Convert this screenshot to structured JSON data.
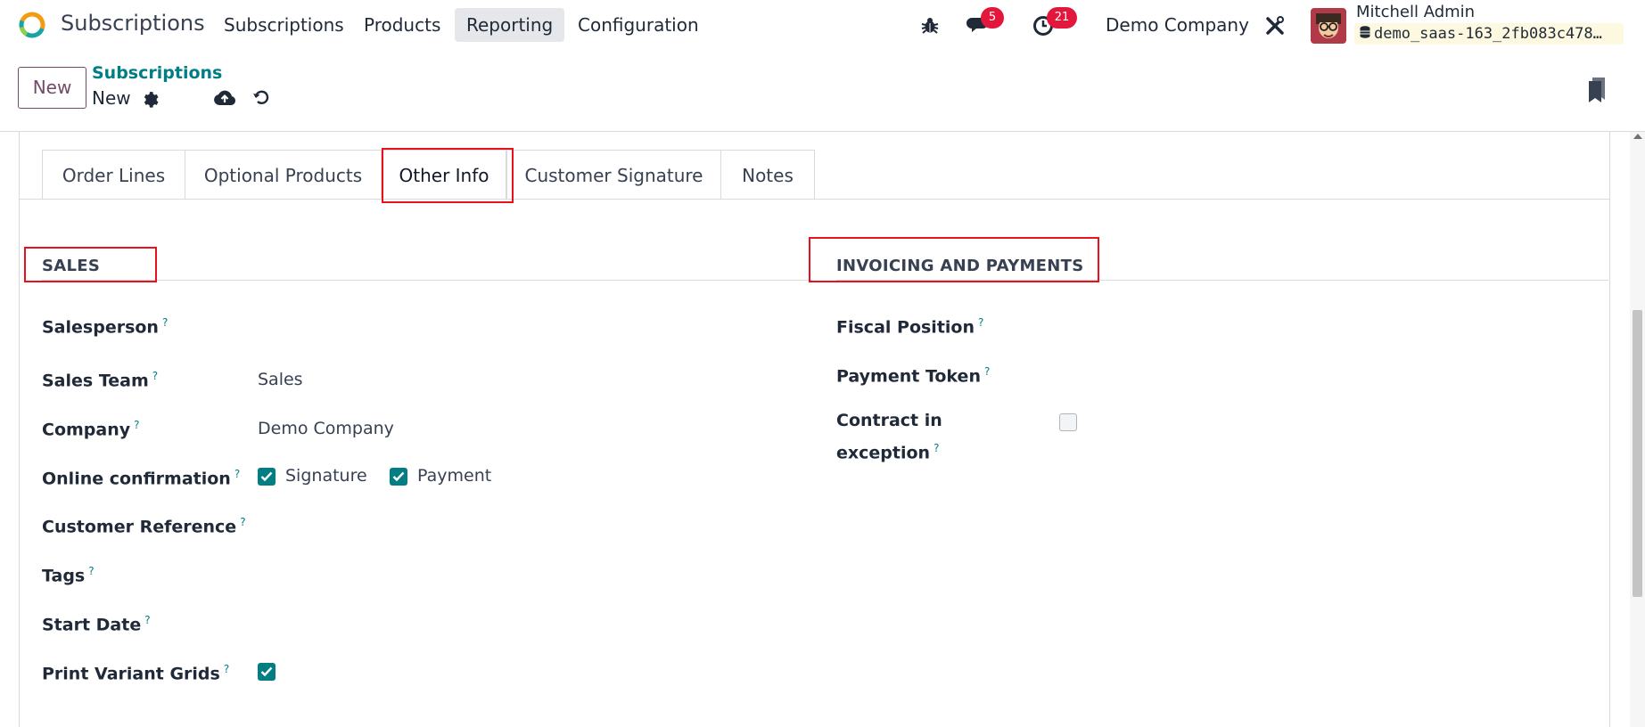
{
  "navbar": {
    "app_name": "Subscriptions",
    "menu": [
      "Subscriptions",
      "Products",
      "Reporting",
      "Configuration"
    ],
    "active_menu": "Reporting",
    "messages_count": "5",
    "activities_count": "21",
    "company": "Demo Company",
    "user_name": "Mitchell Admin",
    "database": "demo_saas-163_2fb083c478…"
  },
  "control": {
    "new_label": "New",
    "breadcrumb": "Subscriptions",
    "record_name": "New"
  },
  "tabs": [
    "Order Lines",
    "Optional Products",
    "Other Info",
    "Customer Signature",
    "Notes"
  ],
  "active_tab": "Other Info",
  "sales": {
    "title": "SALES",
    "salesperson_label": "Salesperson",
    "sales_team_label": "Sales Team",
    "sales_team_value": "Sales",
    "company_label": "Company",
    "company_value": "Demo Company",
    "online_confirmation_label": "Online confirmation",
    "signature_label": "Signature",
    "signature_checked": true,
    "payment_label": "Payment",
    "payment_checked": true,
    "customer_reference_label": "Customer Reference",
    "tags_label": "Tags",
    "start_date_label": "Start Date",
    "print_variant_grids_label": "Print Variant Grids",
    "print_variant_grids_checked": true
  },
  "invoicing": {
    "title": "INVOICING AND PAYMENTS",
    "fiscal_position_label": "Fiscal Position",
    "payment_token_label": "Payment Token",
    "contract_exception_label_line1": "Contract in",
    "contract_exception_label_line2": "exception",
    "contract_exception_checked": false
  },
  "help_marker": "?",
  "colors": {
    "accent": "#017e84",
    "brand": "#714b67",
    "badge": "#e3173c",
    "highlight": "#e8121e"
  }
}
